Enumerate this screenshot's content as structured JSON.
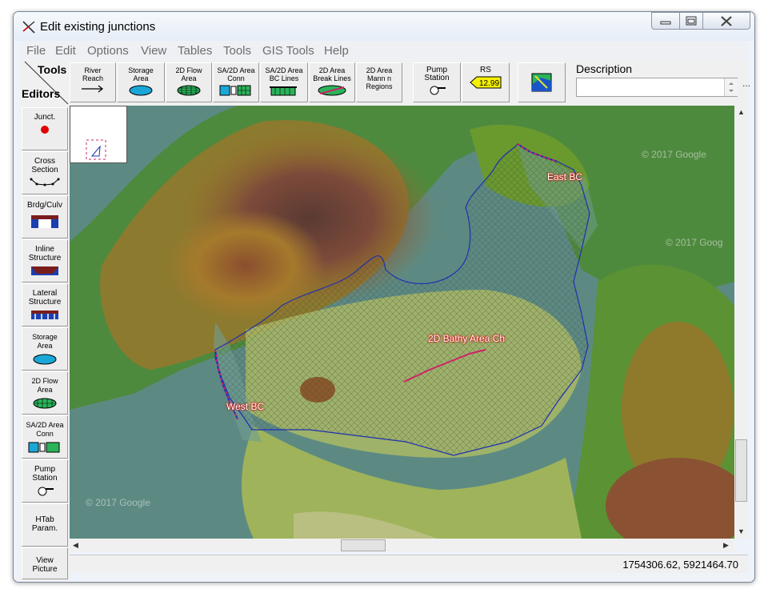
{
  "window": {
    "title": "Edit existing junctions"
  },
  "menu": [
    "File",
    "Edit",
    "Options",
    "View",
    "Tables",
    "Tools",
    "GIS Tools",
    "Help"
  ],
  "toolbar": {
    "tools_label": "Tools",
    "editors_label": "Editors",
    "buttons": [
      {
        "l1": "River",
        "l2": "Reach"
      },
      {
        "l1": "Storage",
        "l2": "Area"
      },
      {
        "l1": "2D Flow",
        "l2": "Area"
      },
      {
        "l1": "SA/2D Area",
        "l2": "Conn"
      },
      {
        "l1": "SA/2D Area",
        "l2": "BC Lines"
      },
      {
        "l1": "2D Area",
        "l2": "Break Lines"
      },
      {
        "l1": "2D Area",
        "l2": "Mann n",
        "l3": "Regions"
      },
      {
        "l1": "Pump",
        "l2": "Station"
      },
      {
        "l1": "RS",
        "l2": "12.99"
      }
    ],
    "description_label": "Description",
    "description_value": "",
    "more_label": "..."
  },
  "sidebar": [
    {
      "l1": "Junct."
    },
    {
      "l1": "Cross",
      "l2": "Section"
    },
    {
      "l1": "Brdg/Culv"
    },
    {
      "l1": "Inline",
      "l2": "Structure"
    },
    {
      "l1": "Lateral",
      "l2": "Structure"
    },
    {
      "l1": "Storage",
      "l2": "Area"
    },
    {
      "l1": "2D Flow",
      "l2": "Area"
    },
    {
      "l1": "SA/2D Area",
      "l2": "Conn"
    },
    {
      "l1": "Pump",
      "l2": "Station"
    },
    {
      "l1": "HTab",
      "l2": "Param."
    },
    {
      "l1": "View",
      "l2": "Picture"
    }
  ],
  "map": {
    "labels": {
      "east_bc": "East BC",
      "west_bc": "West BC",
      "bathy_channel": "2D Bathy Area Ch"
    },
    "watermarks": [
      "© 2017 Google",
      "© 2017 Goog",
      "© 2017 Google"
    ],
    "colors": {
      "boundary": "#1f2fb0",
      "bc_line": "#d0206a",
      "label_halo": "#cc0000"
    }
  },
  "status": {
    "coordinates": "1754306.62, 5921464.70"
  }
}
